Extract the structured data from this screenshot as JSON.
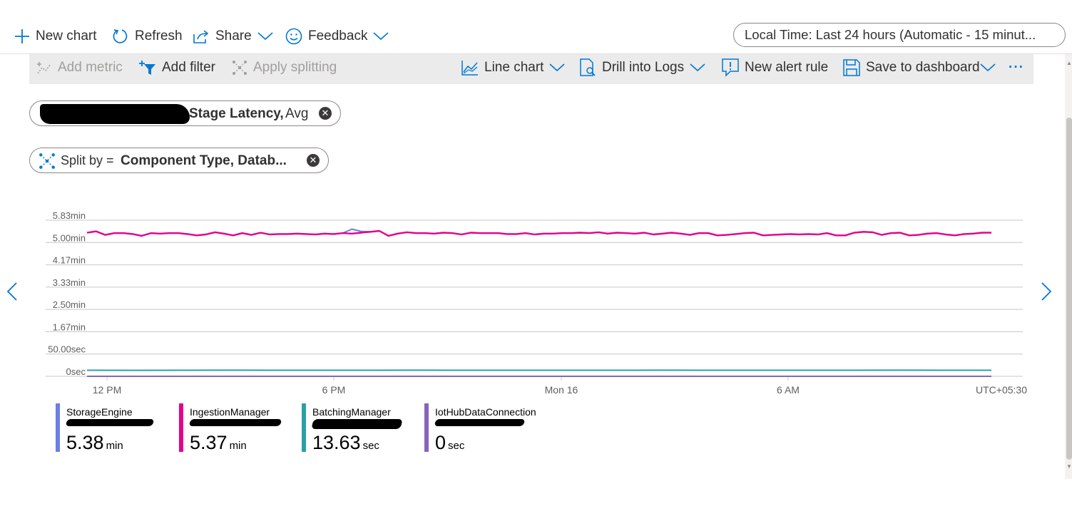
{
  "topbar": {
    "new_chart": "New chart",
    "refresh": "Refresh",
    "share": "Share",
    "feedback": "Feedback",
    "time_range": "Local Time: Last 24 hours (Automatic - 15 minut..."
  },
  "toolbar": {
    "add_metric": "Add metric",
    "add_filter": "Add filter",
    "apply_splitting": "Apply splitting",
    "line_chart": "Line chart",
    "drill_logs": "Drill into Logs",
    "new_alert": "New alert rule",
    "save_dashboard": "Save to dashboard",
    "more": "···"
  },
  "metric_pill": {
    "metric": "Stage Latency,",
    "aggregation": "Avg"
  },
  "split_pill": {
    "prefix": "Split by =",
    "value": "Component Type, Datab..."
  },
  "chart_data": {
    "type": "line",
    "y_ticks": [
      "5.83min",
      "5.00min",
      "4.17min",
      "3.33min",
      "2.50min",
      "1.67min",
      "50.00sec",
      "0sec"
    ],
    "x_ticks": [
      "12 PM",
      "6 PM",
      "Mon 16",
      "6 AM"
    ],
    "timezone": "UTC+05:30",
    "ylim_seconds": [
      0,
      350
    ],
    "grid": true,
    "series": [
      {
        "name": "StorageEngine",
        "color": "#6b7fe6",
        "values": [
          322,
          325,
          317,
          321,
          321,
          319,
          315,
          321,
          320,
          321,
          321,
          319,
          316,
          318,
          323,
          320,
          316,
          321,
          317,
          322,
          318,
          319,
          319,
          320,
          319,
          318,
          320,
          319,
          321,
          330,
          325,
          324,
          326,
          315,
          320,
          323,
          321,
          321,
          320,
          322,
          321,
          318,
          322,
          321,
          321,
          321,
          319,
          319,
          321,
          318,
          320,
          320,
          321,
          321,
          322,
          321,
          323,
          320,
          322,
          321,
          320,
          322,
          318,
          320,
          322,
          320,
          317,
          321,
          321,
          316,
          317,
          319,
          321,
          322,
          316,
          317,
          318,
          319,
          318,
          319,
          318,
          321,
          316,
          316,
          322,
          324,
          323,
          317,
          321,
          322,
          316,
          317,
          320,
          321,
          318,
          316,
          319,
          320,
          322,
          322
        ]
      },
      {
        "name": "IngestionManager",
        "color": "#e3008c",
        "values": [
          322,
          325,
          317,
          321,
          321,
          319,
          315,
          321,
          320,
          321,
          321,
          319,
          316,
          318,
          323,
          320,
          316,
          321,
          317,
          322,
          318,
          319,
          319,
          320,
          319,
          318,
          320,
          319,
          321,
          320,
          322,
          324,
          326,
          315,
          320,
          323,
          321,
          321,
          320,
          322,
          321,
          318,
          322,
          321,
          321,
          321,
          319,
          319,
          321,
          318,
          320,
          320,
          321,
          321,
          322,
          321,
          323,
          320,
          322,
          321,
          320,
          322,
          318,
          320,
          322,
          320,
          317,
          321,
          321,
          316,
          317,
          319,
          321,
          322,
          316,
          317,
          318,
          319,
          318,
          319,
          318,
          321,
          316,
          316,
          322,
          324,
          323,
          317,
          321,
          322,
          316,
          317,
          320,
          321,
          318,
          316,
          319,
          320,
          322,
          322
        ]
      },
      {
        "name": "BatchingManager",
        "color": "#2aa0a4",
        "values": [
          13.6,
          13.5,
          13.6,
          13.7,
          13.6,
          13.6,
          13.6,
          13.7,
          13.6,
          13.6,
          13.6,
          13.6,
          13.7,
          13.6,
          13.6,
          13.6,
          13.6,
          13.7,
          13.6,
          13.6
        ]
      },
      {
        "name": "IotHubDataConnection",
        "color": "#8764b8",
        "values": [
          0,
          0,
          0,
          0,
          0,
          0,
          0,
          0,
          0,
          0,
          0,
          0,
          0,
          0,
          0,
          0,
          0,
          0,
          0,
          0
        ]
      }
    ]
  },
  "legend": [
    {
      "name": "StorageEngine",
      "value": "5.38",
      "unit": "min",
      "color": "#6b7fe6"
    },
    {
      "name": "IngestionManager",
      "value": "5.37",
      "unit": "min",
      "color": "#e3008c"
    },
    {
      "name": "BatchingManager",
      "value": "13.63",
      "unit": "sec",
      "color": "#2aa0a4"
    },
    {
      "name": "IotHubDataConnection",
      "value": "0",
      "unit": "sec",
      "color": "#8764b8"
    }
  ]
}
